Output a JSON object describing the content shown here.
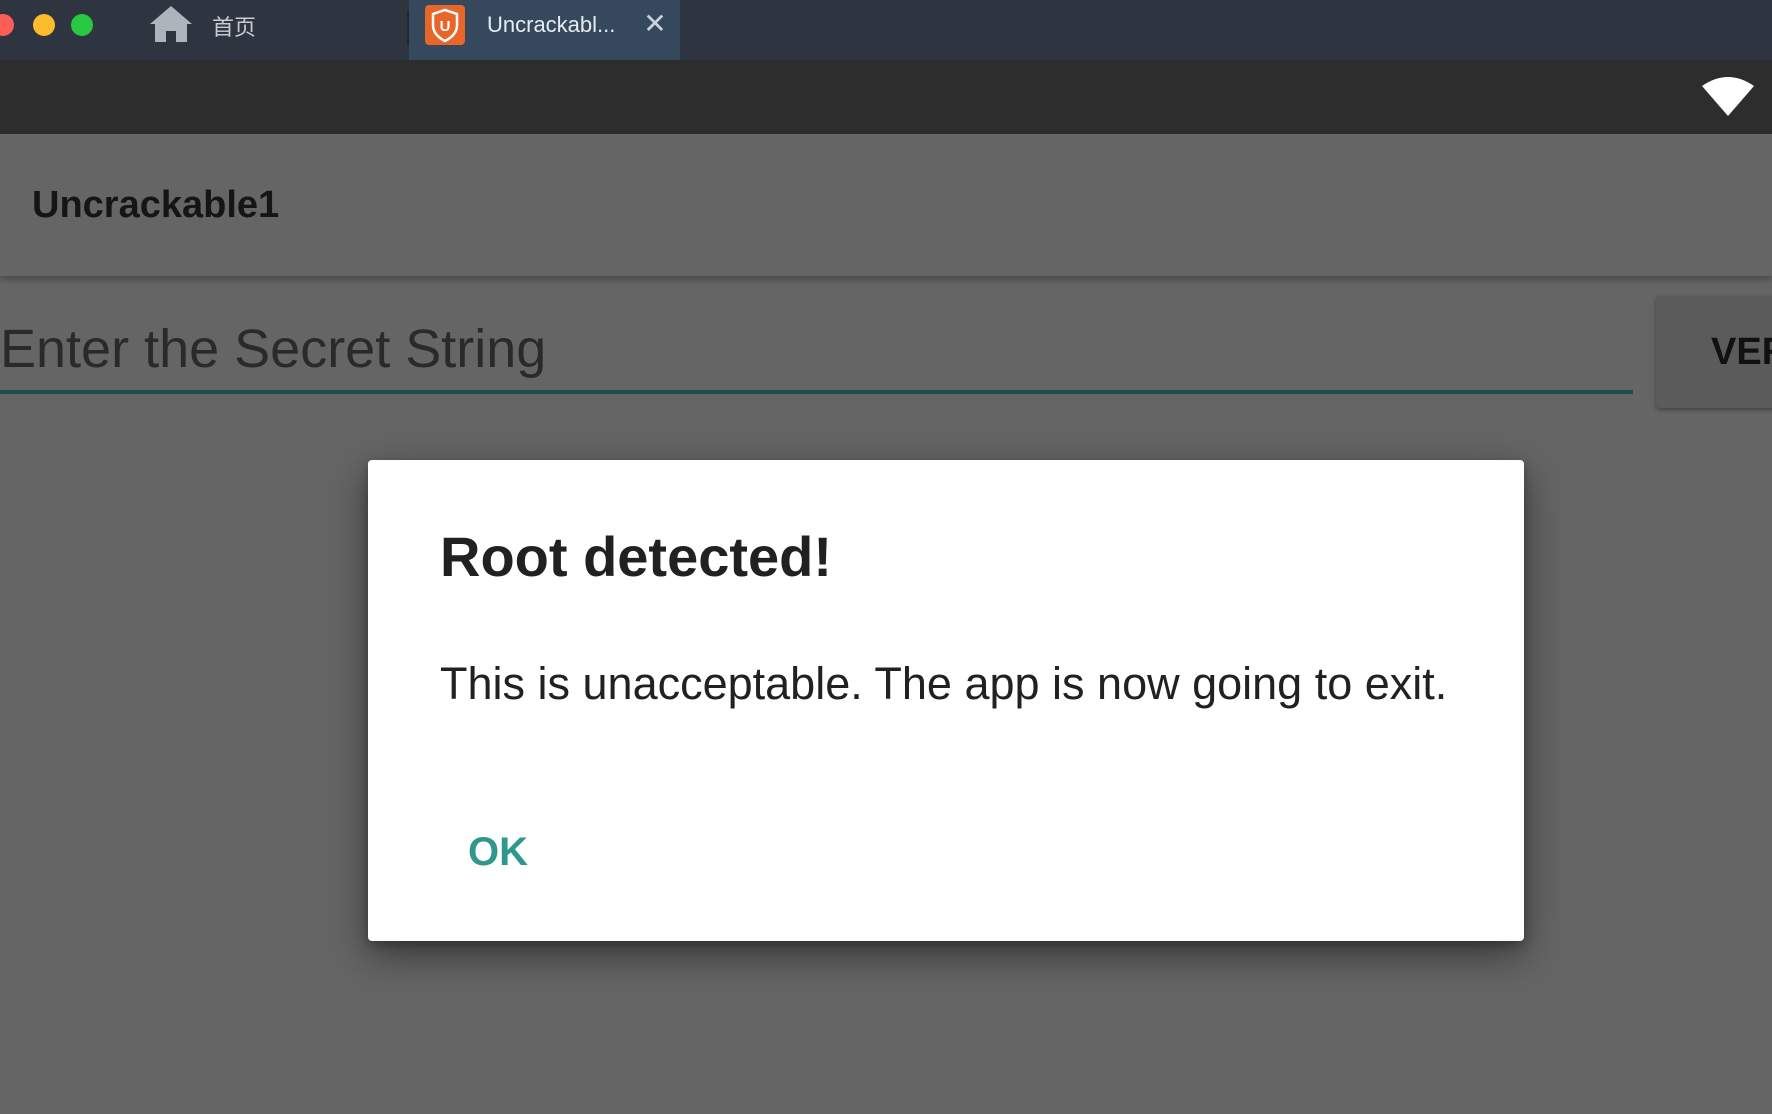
{
  "host_window": {
    "home_tab": {
      "label": "首页",
      "icon": "home-icon"
    },
    "app_tab": {
      "title": "Uncrackabl...",
      "favicon": "shield-u-icon",
      "close_glyph": "✕"
    }
  },
  "status_bar": {
    "icons": [
      "wifi-icon"
    ]
  },
  "app": {
    "title": "Uncrackable1",
    "input": {
      "placeholder": "Enter the Secret String",
      "value": ""
    },
    "verify_label": "VERIFY"
  },
  "dialog": {
    "title": "Root detected!",
    "message": "This is unacceptable. The app is now going to exit.",
    "ok_label": "OK"
  },
  "colors": {
    "accent": "#2f978e",
    "input_underline": "#1d4f4a",
    "favicon": "#e8662a",
    "active_tab": "#36495c"
  }
}
